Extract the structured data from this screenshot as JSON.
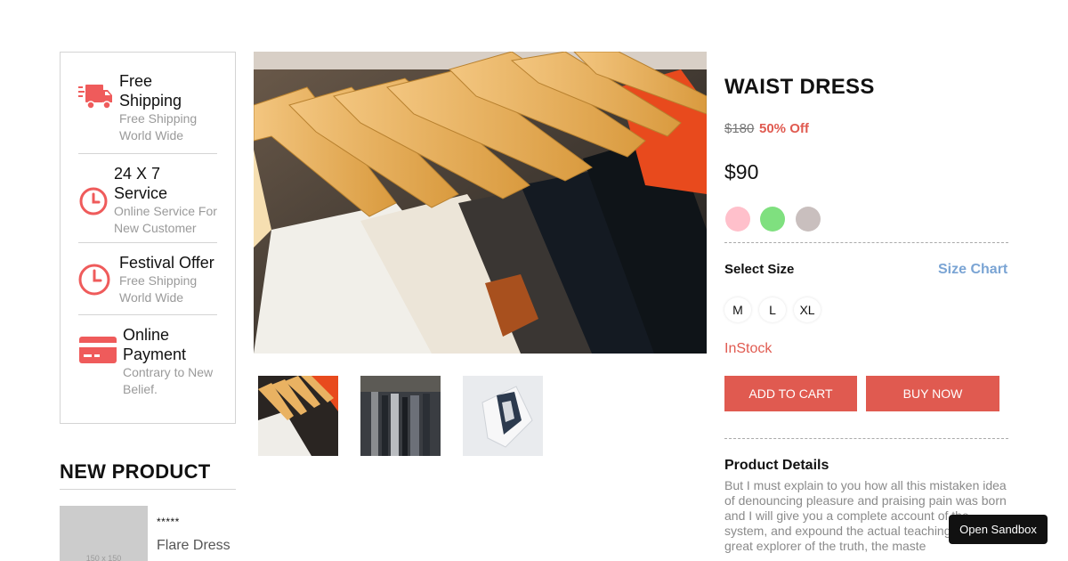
{
  "features": [
    {
      "icon": "truck-icon",
      "title": "Free Shipping",
      "desc": "Free Shipping World Wide"
    },
    {
      "icon": "clock-icon",
      "title": "24 X 7 Service",
      "desc": "Online Service For New Customer"
    },
    {
      "icon": "clock-icon",
      "title": "Festival Offer",
      "desc": "Free Shipping World Wide"
    },
    {
      "icon": "credit-card-icon",
      "title": "Online Payment",
      "desc": "Contrary to New Belief."
    }
  ],
  "new_product": {
    "heading": "NEW PRODUCT",
    "placeholder": "150 x 150",
    "stars": "*****",
    "name": "Flare Dress"
  },
  "product": {
    "name": "WAIST DRESS",
    "old_price": "$180",
    "discount": "50% Off",
    "price": "$90",
    "colors": [
      "#ffc0cb",
      "#7fe07f",
      "#c9bfbe"
    ],
    "select_size_label": "Select Size",
    "size_chart_label": "Size Chart",
    "sizes": [
      "M",
      "L",
      "XL"
    ],
    "stock": "InStock",
    "add_to_cart": "ADD TO CART",
    "buy_now": "BUY NOW",
    "details_title": "Product Details",
    "details_text": "But I must explain to you how all this mistaken idea of denouncing pleasure and praising pain was born and I will give you a complete account of the system, and expound the actual teachings of the great explorer of the truth, the maste"
  },
  "sandbox_label": "Open Sandbox",
  "accent_color": "#e05a50"
}
